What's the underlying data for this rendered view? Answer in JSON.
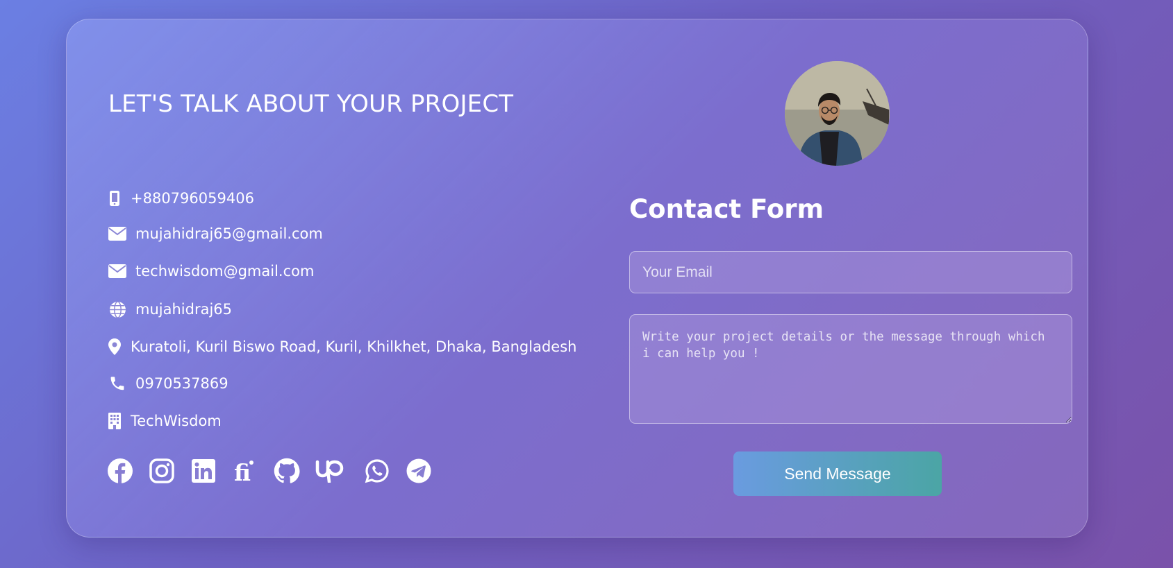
{
  "headline": "LET'S TALK ABOUT YOUR PROJECT",
  "contact_info": [
    {
      "icon": "mobile-phone-icon",
      "text": "+880796059406"
    },
    {
      "icon": "envelope-icon",
      "text": "mujahidraj65@gmail.com"
    },
    {
      "icon": "envelope-icon",
      "text": "techwisdom@gmail.com"
    },
    {
      "icon": "globe-icon",
      "text": "mujahidraj65"
    },
    {
      "icon": "map-pin-icon",
      "text": "Kuratoli, Kuril Biswo Road, Kuril, Khilkhet, Dhaka, Bangladesh"
    },
    {
      "icon": "phone-icon",
      "text": "0970537869"
    },
    {
      "icon": "building-icon",
      "text": "TechWisdom"
    }
  ],
  "social_links": [
    "facebook-icon",
    "instagram-icon",
    "linkedin-icon",
    "fiverr-icon",
    "github-icon",
    "upwork-icon",
    "whatsapp-icon",
    "telegram-icon"
  ],
  "form": {
    "title": "Contact Form",
    "email_placeholder": "Your Email",
    "message_placeholder": "Write your project details or the message through which i can help you !",
    "submit_label": "Send Message"
  },
  "colors": {
    "background_start": "#6b7fe3",
    "background_end": "#7a52aa",
    "button_start": "#6a9be0",
    "button_end": "#4ba5a5",
    "text": "#ffffff"
  }
}
